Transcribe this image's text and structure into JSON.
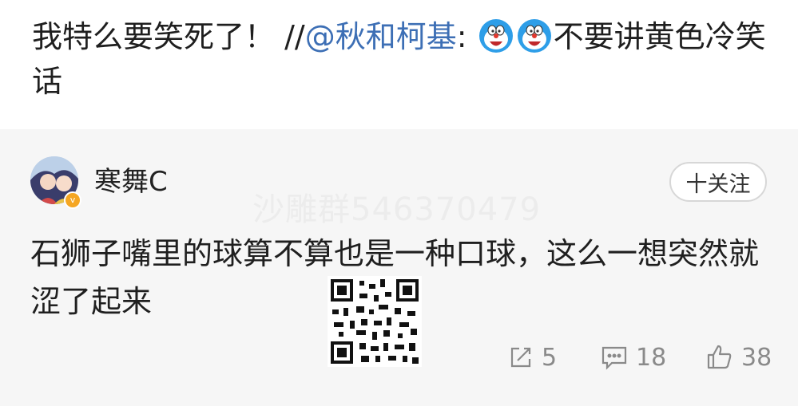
{
  "post": {
    "repost_text": "我特么要笑死了！ //",
    "mention": "@秋和柯基",
    "colon": ":",
    "after_emoji_text": "不要讲黄色冷笑话",
    "emoji_icons": [
      "doraemon-icon",
      "doraemon-icon"
    ]
  },
  "comment": {
    "username": "寒舞C",
    "follow_label": "十关注",
    "text": "石狮子嘴里的球算不算也是一种口球，这么一想突然就涩了起来",
    "watermark": "沙雕群546370479",
    "actions": {
      "share_count": "5",
      "comment_count": "18",
      "like_count": "38"
    }
  },
  "colors": {
    "mention": "#3d6fb5",
    "card_bg": "#f6f6f6",
    "badge": "#f5a623"
  }
}
